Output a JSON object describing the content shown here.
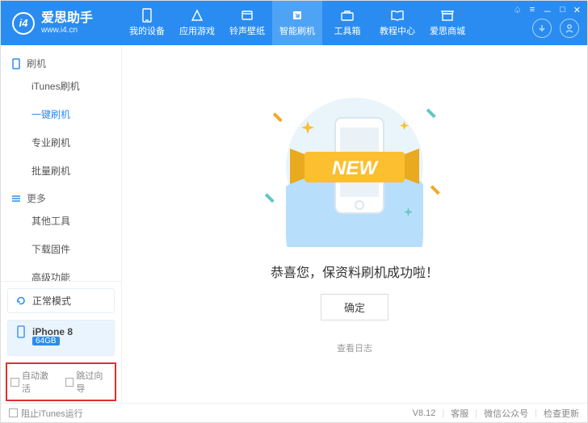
{
  "app": {
    "title": "爱思助手",
    "subtitle": "www.i4.cn",
    "logo_text": "i4"
  },
  "tabs": [
    {
      "label": "我的设备"
    },
    {
      "label": "应用游戏"
    },
    {
      "label": "铃声壁纸"
    },
    {
      "label": "智能刷机"
    },
    {
      "label": "工具箱"
    },
    {
      "label": "教程中心"
    },
    {
      "label": "爱思商城"
    }
  ],
  "sidebar": {
    "section1": "刷机",
    "items1": [
      "iTunes刷机",
      "一键刷机",
      "专业刷机",
      "批量刷机"
    ],
    "section2": "更多",
    "items2": [
      "其他工具",
      "下载固件",
      "高级功能"
    ],
    "mode_normal": "正常模式",
    "device": "iPhone 8",
    "device_badge": "64GB",
    "check_auto": "自动激活",
    "check_skip": "跳过向导"
  },
  "main": {
    "new_badge": "NEW",
    "success_text": "恭喜您，保资料刷机成功啦！",
    "ok": "确定",
    "log": "查看日志"
  },
  "footer": {
    "block_itunes": "阻止iTunes运行",
    "version": "V8.12",
    "service": "客服",
    "wechat": "微信公众号",
    "update": "检查更新"
  }
}
